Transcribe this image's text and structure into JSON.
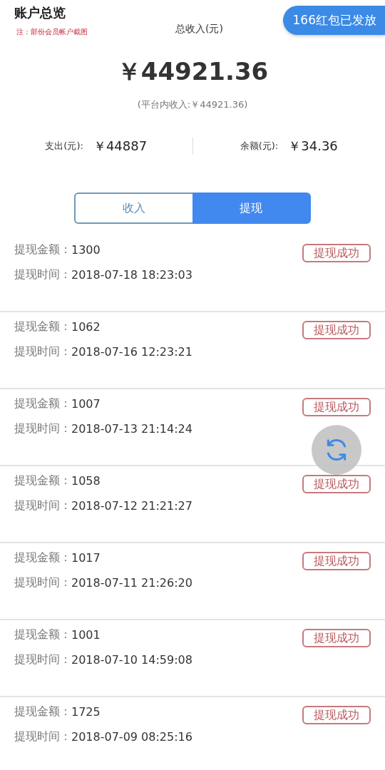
{
  "header": {
    "title": "账户总览",
    "note": "注：部份会员帐户截图",
    "income_label": "总收入(元)",
    "promo": "166红包已发放"
  },
  "total": {
    "amount": "￥44921.36",
    "sub": "(平台内收入:￥44921.36)"
  },
  "stats": [
    {
      "label": "支出(元):",
      "value": "￥44887"
    },
    {
      "label": "余额(元):",
      "value": "￥34.36"
    }
  ],
  "tabs": [
    {
      "label": "收入",
      "selected": false
    },
    {
      "label": "提现",
      "selected": true
    }
  ],
  "records": [
    {
      "amount_label": "提现金额：",
      "amount": "1300",
      "time_label": "提现时间：",
      "time": "2018-07-18 18:23:03",
      "status": "提现成功"
    },
    {
      "amount_label": "提现金额：",
      "amount": "1062",
      "time_label": "提现时间：",
      "time": "2018-07-16 12:23:21",
      "status": "提现成功"
    },
    {
      "amount_label": "提现金额：",
      "amount": "1007",
      "time_label": "提现时间：",
      "time": "2018-07-13 21:14:24",
      "status": "提现成功"
    },
    {
      "amount_label": "提现金额：",
      "amount": "1058",
      "time_label": "提现时间：",
      "time": "2018-07-12 21:21:27",
      "status": "提现成功"
    },
    {
      "amount_label": "提现金额：",
      "amount": "1017",
      "time_label": "提现时间：",
      "time": "2018-07-11 21:26:20",
      "status": "提现成功"
    },
    {
      "amount_label": "提现金额：",
      "amount": "1001",
      "time_label": "提现时间：",
      "time": "2018-07-10 14:59:08",
      "status": "提现成功"
    },
    {
      "amount_label": "提现金额：",
      "amount": "1725",
      "time_label": "提现时间：",
      "time": "2018-07-09 08:25:16",
      "status": "提现成功"
    }
  ]
}
